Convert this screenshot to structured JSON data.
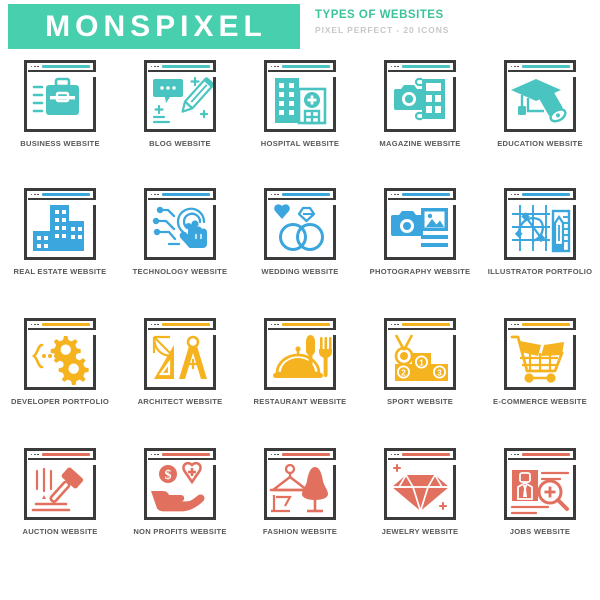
{
  "header": {
    "brand": "MONSPIXEL",
    "title": "TYPES OF WEBSITES",
    "subtitle": "PIXEL PERFECT - 20 ICONS",
    "brand_bg": "#48cfad",
    "title_color": "#3bc49a",
    "subtitle_color": "#c8c8c8"
  },
  "palette": {
    "row1": "#4ac4c0",
    "row2": "#3ba5dd",
    "row3": "#f5b320",
    "row4": "#e2705f",
    "frame": "#3b3b3b",
    "label": "#58585a"
  },
  "rows": [
    {
      "color": "#4ac4c0",
      "cells": [
        {
          "icon": "briefcase-icon",
          "label": "BUSINESS WEBSITE"
        },
        {
          "icon": "chat-pencil-icon",
          "label": "BLOG WEBSITE"
        },
        {
          "icon": "hospital-icon",
          "label": "HOSPITAL WEBSITE"
        },
        {
          "icon": "camera-grid-icon",
          "label": "MAGAZINE WEBSITE"
        },
        {
          "icon": "graduation-cap-icon",
          "label": "EDUCATION WEBSITE"
        }
      ]
    },
    {
      "color": "#3ba5dd",
      "cells": [
        {
          "icon": "buildings-icon",
          "label": "REAL ESTATE WEBSITE"
        },
        {
          "icon": "circuit-hand-icon",
          "label": "TECHNOLOGY WEBSITE"
        },
        {
          "icon": "wedding-rings-icon",
          "label": "WEDDING WEBSITE"
        },
        {
          "icon": "camera-photo-icon",
          "label": "PHOTOGRAPHY WEBSITE"
        },
        {
          "icon": "pen-tool-ruler-icon",
          "label": "ILLUSTRATOR PORTFOLIO"
        }
      ]
    },
    {
      "color": "#f5b320",
      "cells": [
        {
          "icon": "gears-code-icon",
          "label": "DEVELOPER PORTFOLIO"
        },
        {
          "icon": "compass-ruler-icon",
          "label": "ARCHITECT WEBSITE"
        },
        {
          "icon": "cloche-cutlery-icon",
          "label": "RESTAURANT WEBSITE"
        },
        {
          "icon": "podium-medal-icon",
          "label": "SPORT WEBSITE"
        },
        {
          "icon": "shopping-cart-icon",
          "label": "E-COMMERCE WEBSITE"
        }
      ]
    },
    {
      "color": "#e2705f",
      "cells": [
        {
          "icon": "gavel-icon",
          "label": "AUCTION WEBSITE"
        },
        {
          "icon": "hand-heart-donation-icon",
          "label": "NON PROFITS WEBSITE"
        },
        {
          "icon": "hanger-mannequin-icon",
          "label": "FASHION WEBSITE"
        },
        {
          "icon": "diamond-icon",
          "label": "JEWELRY WEBSITE"
        },
        {
          "icon": "resume-search-icon",
          "label": "JOBS WEBSITE"
        }
      ]
    }
  ],
  "podium_numbers": [
    "1",
    "2",
    "3"
  ]
}
